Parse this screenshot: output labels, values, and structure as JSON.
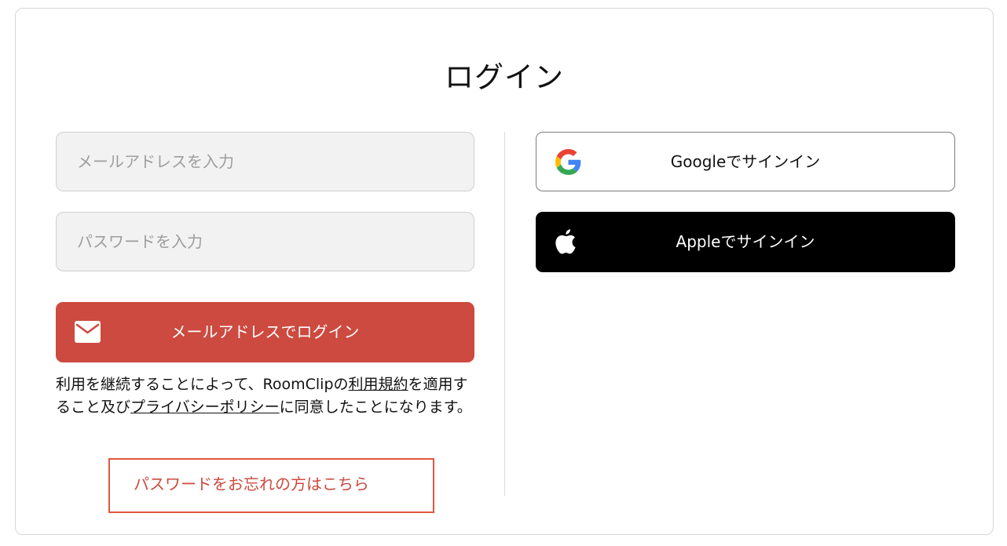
{
  "page": {
    "title": "ログイン"
  },
  "form": {
    "email_placeholder": "メールアドレスを入力",
    "password_placeholder": "パスワードを入力",
    "email_login_label": "メールアドレスでログイン"
  },
  "terms": {
    "prefix": "利用を継続することによって、RoomClipの",
    "terms_link": "利用規約",
    "middle": "を適用すること及び",
    "privacy_link": "プライバシーポリシー",
    "suffix": "に同意したことになります。"
  },
  "forgot_password": {
    "label": "パスワードをお忘れの方はこちら"
  },
  "social": {
    "google_label": "Googleでサインイン",
    "apple_label": "Appleでサインイン"
  },
  "icons": {
    "mail": "mail-icon",
    "google": "google-icon",
    "apple": "apple-icon"
  },
  "colors": {
    "accent": "#cc4a3f",
    "forgot_border": "#e1573f",
    "apple_bg": "#000000",
    "input_bg": "#f2f2f2"
  }
}
